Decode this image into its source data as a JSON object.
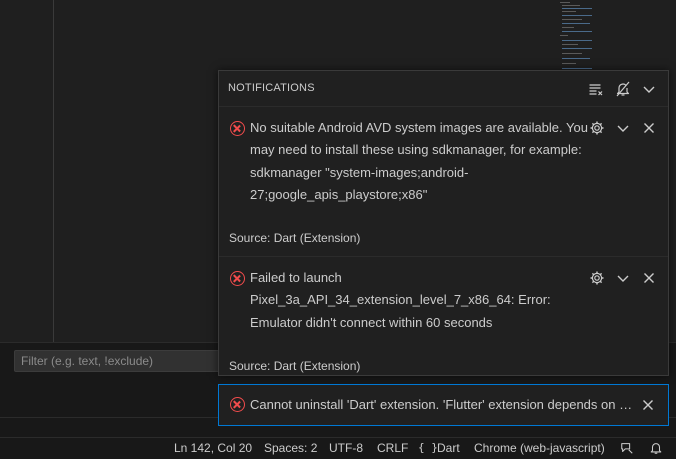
{
  "filter": {
    "placeholder": "Filter (e.g. text, !exclude)"
  },
  "notifications": {
    "title": "NOTIFICATIONS",
    "icons": {
      "clear_all": "clear-all-icon",
      "do_not_disturb": "bell-slash-icon",
      "collapse": "chevron-down-icon"
    },
    "items": [
      {
        "severity": "error",
        "message": "No suitable Android AVD system images are available. You may need to install these using sdkmanager, for example: sdkmanager \"system-images;android-27;google_apis_playstore;x86\"",
        "source": "Source: Dart (Extension)"
      },
      {
        "severity": "error",
        "message": "Failed to launch Pixel_3a_API_34_extension_level_7_x86_64: Error: Emulator didn't connect within 60 seconds",
        "source": "Source: Dart (Extension)"
      },
      {
        "severity": "error",
        "message": "Cannot uninstall 'Dart' extension. 'Flutter' extension depends on this."
      }
    ]
  },
  "statusbar": {
    "position": "Ln 142, Col 20",
    "indent": "Spaces: 2",
    "encoding": "UTF-8",
    "eol": "CRLF",
    "language_icon": "{ }",
    "language": "Dart",
    "device": "Chrome (web-javascript)"
  },
  "colors": {
    "error": "#f14c4c",
    "focus_border": "#0078d4",
    "background": "#1f1f1f"
  }
}
